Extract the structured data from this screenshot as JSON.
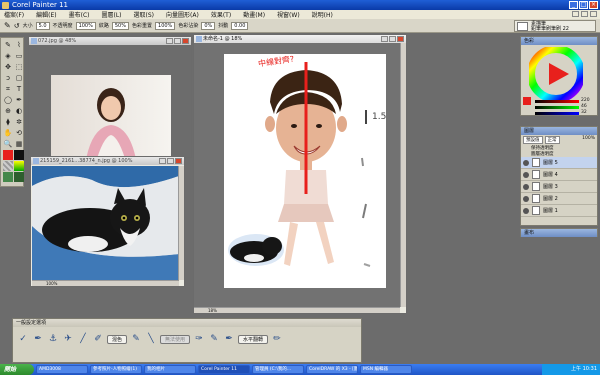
{
  "app": {
    "title": "Corel Painter 11"
  },
  "menu": [
    "檔案(F)",
    "編輯(E)",
    "畫布(C)",
    "圖層(L)",
    "選取(S)",
    "向量圖形(A)",
    "效果(T)",
    "動畫(M)",
    "視窗(W)",
    "說明(H)"
  ],
  "propbar": {
    "size_label": "大小",
    "size_value": "5.0",
    "opacity_label": "不透明度",
    "opacity_value": "100%",
    "grain_label": "紋路",
    "grain_value": "50%",
    "resat_label": "色彩重置",
    "resat_value": "100%",
    "bleed_label": "色彩沾染",
    "bleed_value": "0%",
    "jitter_label": "抖動",
    "jitter_value": "0.00"
  },
  "brush_selector": {
    "category": "素描筆",
    "variant": "鉛筆筆刷筆刷 22"
  },
  "colors": {
    "main": "#e8201c",
    "secondary": "#111111",
    "accent": "#e8201c"
  },
  "windows": {
    "photo": {
      "title": "072.jpg @ 48%"
    },
    "cat": {
      "title": "215159_2161...38774_n.jpg @ 100%",
      "zoom": "100%"
    },
    "main": {
      "title": "未命名-1 @ 18%",
      "annotation": "中線對齊?",
      "mark_1": "1.5",
      "zoom": "18%"
    }
  },
  "color_panel": {
    "title": "色彩",
    "values": [
      "220",
      "46",
      "32"
    ]
  },
  "layers_panel": {
    "title": "圖層",
    "mode": "預設值",
    "composite": "正常",
    "opacity": "100%",
    "check_label": "保持透明度",
    "lock_label": "圖層透明度",
    "layers": [
      "圖層 5",
      "圖層 4",
      "圖層 3",
      "圖層 2",
      "圖層 1",
      "畫布"
    ]
  },
  "bottom_panel": {
    "title": "一般設定選項",
    "btn_1": "混色",
    "btn_2": "無法使用",
    "btn_3": "水平翻轉"
  },
  "taskbar": {
    "start": "開始",
    "tasks": [
      "Corel Painter 11",
      "AMD3008",
      "參考照片-人物照繪(1)",
      "我的相片",
      "Corel Painter 11",
      "管理員 (C:\\我的...",
      "CorelDRAW 的 X3 - [圖...",
      "MSN 編輯器"
    ],
    "tray_time": "上午 10:31"
  }
}
